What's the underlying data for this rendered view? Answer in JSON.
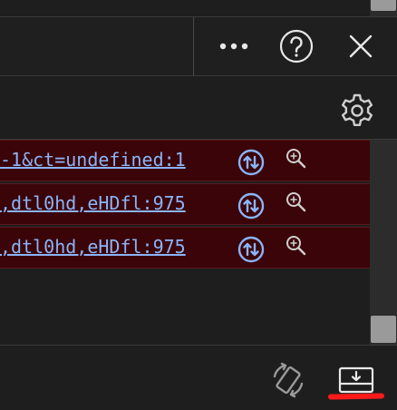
{
  "toolbar": {
    "more_icon": "more-horizontal-icon",
    "help_icon": "help-circle-icon",
    "close_icon": "close-icon"
  },
  "subbar": {
    "settings_icon": "gear-icon"
  },
  "rows": [
    {
      "link": "-1&ct=undefined:1"
    },
    {
      "link": ",dtl0hd,eHDfl:975"
    },
    {
      "link": ",dtl0hd,eHDfl:975"
    }
  ],
  "bottom": {
    "rotate_icon": "rotate-icon",
    "dock_icon": "dock-to-bottom-icon"
  },
  "colors": {
    "background": "#1e1e1e",
    "row_error": "#3b0408",
    "link": "#8ab4f8",
    "annotation": "#ff1a1a"
  }
}
